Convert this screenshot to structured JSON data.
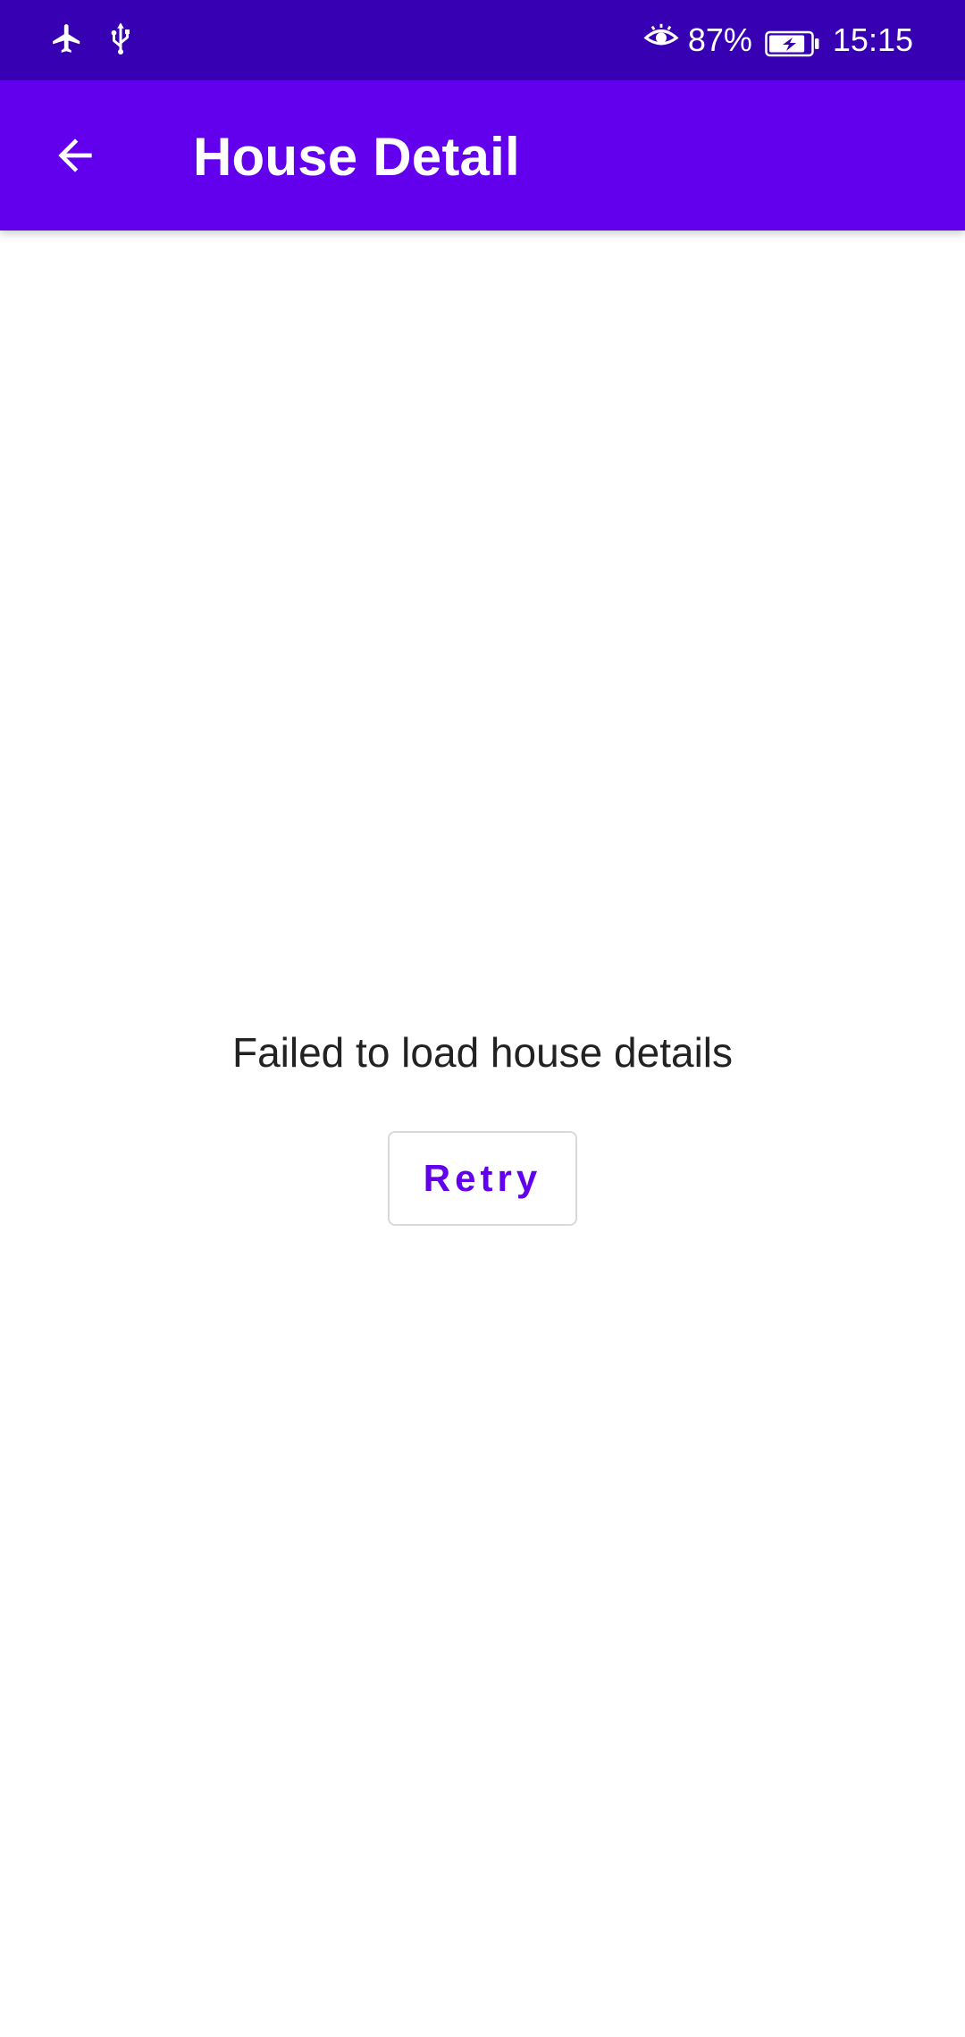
{
  "colors": {
    "status_bar": "#3700B3",
    "app_bar": "#6200EE",
    "accent": "#6200EE",
    "background": "#FFFFFF",
    "message_text": "#222222"
  },
  "status_bar": {
    "left_icons": [
      "airplane-icon",
      "usb-icon"
    ],
    "right_icons": [
      "eye-icon",
      "battery-charging-icon"
    ],
    "battery_percent": "87%",
    "battery_level": 0.87,
    "time": "15:15"
  },
  "app_bar": {
    "back_icon": "arrow-back-icon",
    "title": "House Detail"
  },
  "main": {
    "error_message": "Failed to load house details",
    "retry_label": "Retry"
  }
}
